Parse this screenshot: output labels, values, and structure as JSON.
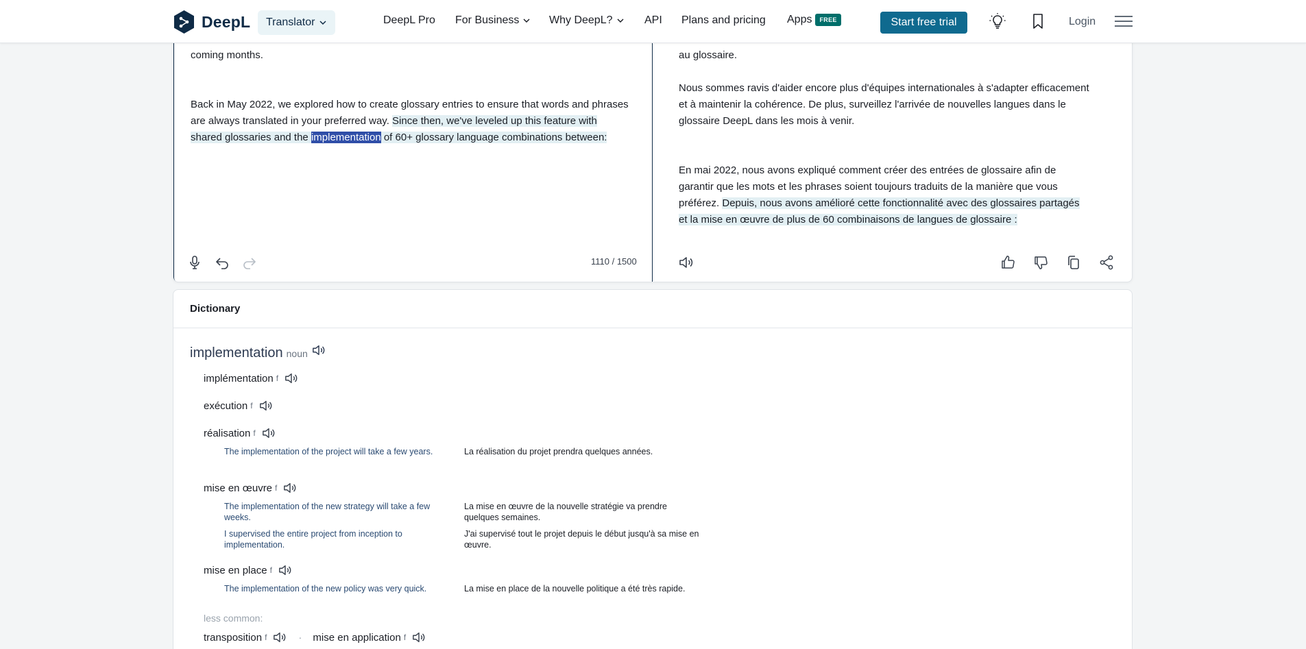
{
  "nav": {
    "logo_text": "DeepL",
    "translator_label": "Translator",
    "links": {
      "pro": "DeepL Pro",
      "business": "For Business",
      "why": "Why DeepL?",
      "api": "API",
      "plans": "Plans and pricing",
      "apps": "Apps"
    },
    "free_badge": "FREE",
    "trial_button": "Start free trial",
    "login": "Login"
  },
  "source": {
    "intro_line": "coming months.",
    "paragraph_start": "Back in May 2022, we explored how to create glossary entries to ensure that words and phrases are always translated in your preferred way. ",
    "hl_1": "Since then, we've leveled up this feature with shared glossaries and the ",
    "selected_word": "implementation",
    "hl_2": " of 60+ glossary language combinations between:",
    "char_count": "1110 / 1500"
  },
  "target": {
    "line_1": "au glossaire.",
    "paragraph_2": "Nous sommes ravis d'aider encore plus d'équipes internationales à s'adapter efficacement et à maintenir la cohérence. De plus, surveillez l'arrivée de nouvelles langues dans le glossaire DeepL dans les mois à venir.",
    "paragraph_3_start": "En mai 2022, nous avons expliqué comment créer des entrées de glossaire afin de garantir que les mots et les phrases soient toujours traduits de la manière que vous préférez. ",
    "paragraph_3_hl": "Depuis, nous avons amélioré cette fonctionnalité avec des glossaires partagés et la mise en œuvre de plus de 60 combinaisons de langues de glossaire :"
  },
  "dictionary": {
    "heading": "Dictionary",
    "headword": "implementation",
    "part_of_speech": "noun",
    "senses": [
      {
        "term": "implémentation",
        "gender": "f"
      },
      {
        "term": "exécution",
        "gender": "f"
      },
      {
        "term": "réalisation",
        "gender": "f",
        "examples": [
          {
            "src": "The implementation of the project will take a few years.",
            "tgt": "La réalisation du projet prendra quelques années."
          }
        ]
      },
      {
        "term": "mise en œuvre",
        "gender": "f",
        "examples": [
          {
            "src": "The implementation of the new strategy will take a few weeks.",
            "tgt": "La mise en œuvre de la nouvelle stratégie va prendre quelques semaines."
          },
          {
            "src": "I supervised the entire project from inception to implementation.",
            "tgt": "J'ai supervisé tout le projet depuis le début jusqu'à sa mise en œuvre."
          }
        ]
      },
      {
        "term": "mise en place",
        "gender": "f",
        "examples": [
          {
            "src": "The implementation of the new policy was very quick.",
            "tgt": "La mise en place de la nouvelle politique a été très rapide."
          }
        ]
      }
    ],
    "less_common_label": "less common:",
    "less_common": [
      {
        "term": "transposition",
        "gender": "f"
      },
      {
        "term": "mise en application",
        "gender": "f"
      }
    ]
  },
  "colors": {
    "brand_dark": "#0f2b46",
    "accent_button": "#0f6a8f",
    "highlight": "#e2eff3",
    "selection": "#2f4ea8",
    "free_badge": "#006e6a"
  }
}
